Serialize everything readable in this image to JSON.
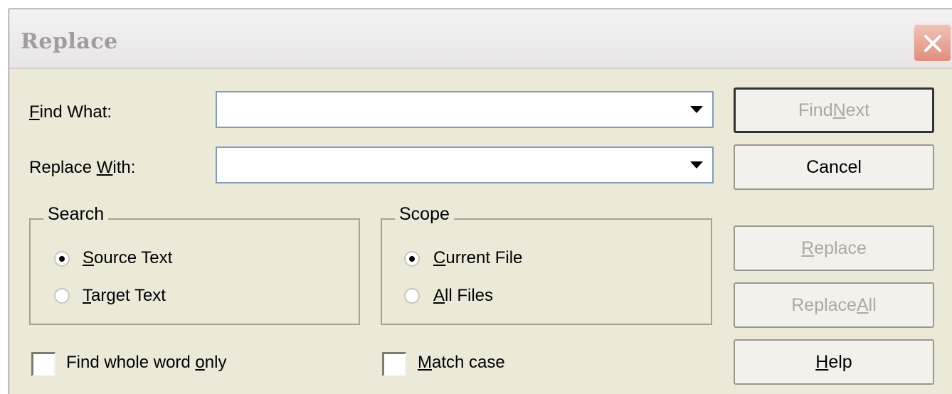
{
  "title": "Replace",
  "find_what": {
    "label_pre": "",
    "label_key": "F",
    "label_post": "ind What:",
    "value": ""
  },
  "replace_with": {
    "label_pre": "Replace ",
    "label_key": "W",
    "label_post": "ith:",
    "value": ""
  },
  "buttons": {
    "find_next": {
      "pre": "Find ",
      "key": "N",
      "post": "ext"
    },
    "cancel": "Cancel",
    "replace": {
      "pre": "",
      "key": "R",
      "post": "eplace"
    },
    "replace_all": {
      "pre": "Replace ",
      "key": "A",
      "post": "ll"
    },
    "help": {
      "pre": "",
      "key": "H",
      "post": "elp"
    }
  },
  "search_group": {
    "legend": "Search",
    "options": [
      {
        "pre": "",
        "key": "S",
        "post": "ource Text",
        "checked": true
      },
      {
        "pre": "",
        "key": "T",
        "post": "arget Text",
        "checked": false
      }
    ]
  },
  "scope_group": {
    "legend": "Scope",
    "options": [
      {
        "pre": "",
        "key": "C",
        "post": "urrent File",
        "checked": true
      },
      {
        "pre": "",
        "key": "A",
        "post": "ll Files",
        "checked": false
      }
    ]
  },
  "checkboxes": {
    "whole_word": {
      "pre": "Find whole word ",
      "key": "o",
      "post": "nly",
      "checked": false
    },
    "match_case": {
      "pre": "",
      "key": "M",
      "post": "atch case",
      "checked": false
    }
  }
}
